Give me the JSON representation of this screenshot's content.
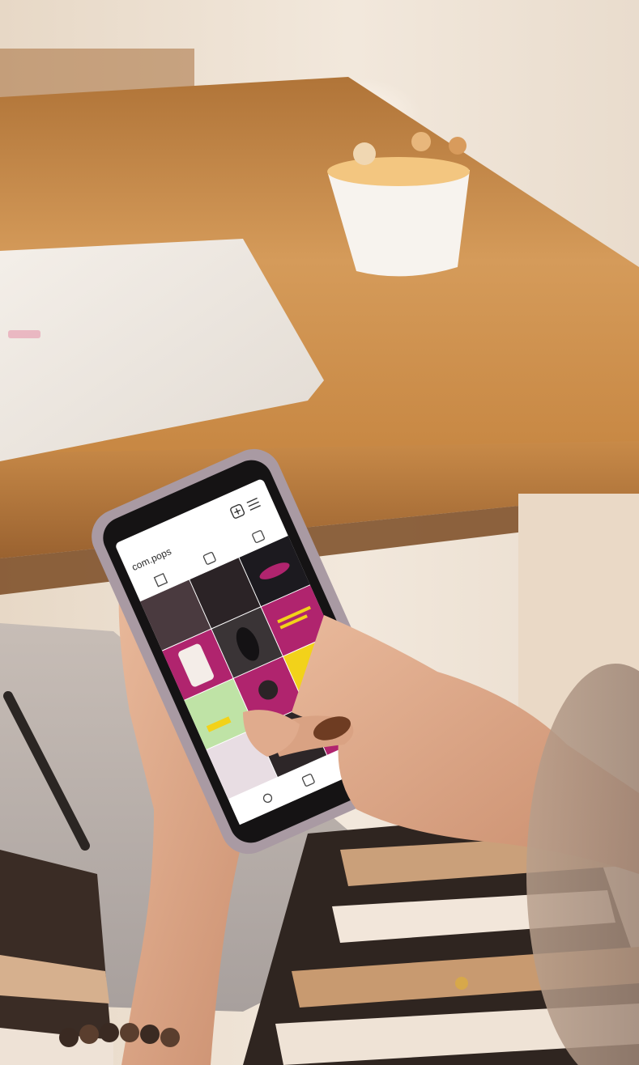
{
  "phone": {
    "app": {
      "username": "com.pops"
    }
  },
  "colors": {
    "brand_magenta": "#b0246e",
    "brand_yellow": "#f2d21a",
    "brand_green": "#bfe3a6",
    "table_wood": "#c98a4a",
    "phone_case": "#a99aa3"
  },
  "icons": {
    "header": [
      "add-icon",
      "menu-icon"
    ],
    "tabs": [
      "grid-icon",
      "reels-icon",
      "tagged-icon"
    ],
    "bottom_nav": [
      "search-icon",
      "reels-icon",
      "profile-icon"
    ]
  }
}
